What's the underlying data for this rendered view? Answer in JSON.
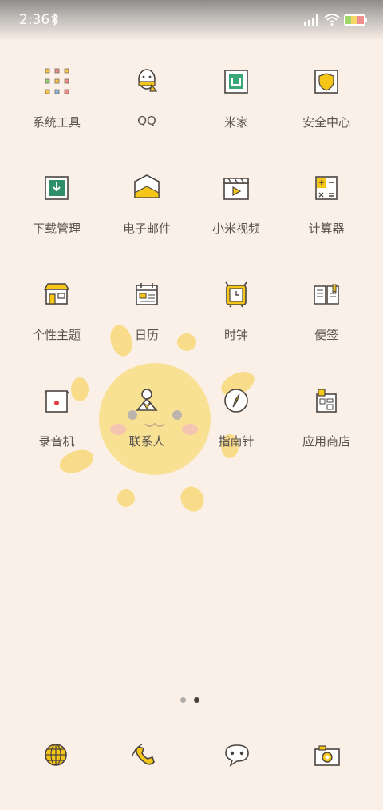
{
  "status_bar": {
    "time": "2:36"
  },
  "apps": [
    {
      "name": "system-tools",
      "label": "系统工具",
      "icon": "folder-grid-icon"
    },
    {
      "name": "qq",
      "label": "QQ",
      "icon": "penguin-icon"
    },
    {
      "name": "mi-home",
      "label": "米家",
      "icon": "mi-home-icon"
    },
    {
      "name": "security-center",
      "label": "安全中心",
      "icon": "shield-icon"
    },
    {
      "name": "downloads",
      "label": "下载管理",
      "icon": "download-icon"
    },
    {
      "name": "email",
      "label": "电子邮件",
      "icon": "envelope-icon"
    },
    {
      "name": "mi-video",
      "label": "小米视频",
      "icon": "clapperboard-icon"
    },
    {
      "name": "calculator",
      "label": "计算器",
      "icon": "calculator-icon"
    },
    {
      "name": "themes",
      "label": "个性主题",
      "icon": "shop-icon"
    },
    {
      "name": "calendar",
      "label": "日历",
      "icon": "calendar-icon"
    },
    {
      "name": "clock",
      "label": "时钟",
      "icon": "alarm-clock-icon"
    },
    {
      "name": "notes",
      "label": "便签",
      "icon": "notebook-icon"
    },
    {
      "name": "recorder",
      "label": "录音机",
      "icon": "recorder-icon"
    },
    {
      "name": "contacts",
      "label": "联系人",
      "icon": "contact-icon"
    },
    {
      "name": "compass",
      "label": "指南针",
      "icon": "compass-icon"
    },
    {
      "name": "app-store",
      "label": "应用商店",
      "icon": "store-icon"
    }
  ],
  "page_indicator": {
    "pages": 2,
    "current": 2
  },
  "dock": [
    {
      "name": "browser",
      "icon": "globe-icon"
    },
    {
      "name": "phone",
      "icon": "phone-icon"
    },
    {
      "name": "messages",
      "icon": "chat-bubble-icon"
    },
    {
      "name": "camera",
      "icon": "camera-icon"
    }
  ],
  "colors": {
    "background": "#fbf0e8",
    "accent_yellow": "#f5c518",
    "label": "#5a5450"
  }
}
